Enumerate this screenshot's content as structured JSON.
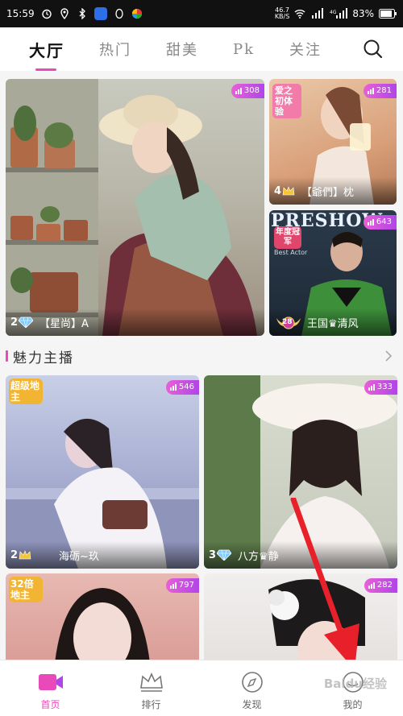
{
  "status_bar": {
    "time": "15:59",
    "net_speed_value": "46.7",
    "net_speed_unit": "KB/S",
    "battery": "83%"
  },
  "tabs": [
    {
      "label": "大厅",
      "active": true
    },
    {
      "label": "热门",
      "active": false
    },
    {
      "label": "甜美",
      "active": false
    },
    {
      "label": "Pk",
      "active": false
    },
    {
      "label": "关注",
      "active": false
    }
  ],
  "hero": {
    "big": {
      "viewers": "308",
      "level": "2",
      "name": "【星尚】A"
    },
    "top_right": {
      "viewers": "281",
      "level": "4",
      "name": "【爺們】枕",
      "poster_text": "爱之初体验"
    },
    "bottom_right": {
      "viewers": "643",
      "level": "28",
      "name": "王国♛清风",
      "poster_text": "PRESHOW",
      "award_text": "年度冠军",
      "sub_text": "Best Actor"
    }
  },
  "section": {
    "title": "魅力主播"
  },
  "grid": [
    {
      "viewers": "546",
      "level": "2",
      "name": "海砺~玖",
      "tag": "超级地主"
    },
    {
      "viewers": "333",
      "level": "3",
      "name": "八方♛静"
    },
    {
      "viewers": "797",
      "tag": "32倍地主"
    },
    {
      "viewers": "282"
    }
  ],
  "bottom_nav": [
    {
      "label": "首页",
      "icon": "video-camera-icon",
      "active": true
    },
    {
      "label": "排行",
      "icon": "crown-icon",
      "active": false
    },
    {
      "label": "发现",
      "icon": "compass-icon",
      "active": false
    },
    {
      "label": "我的",
      "icon": "profile-icon",
      "active": false
    }
  ],
  "watermark": "Baidu经验",
  "colors": {
    "accent": "#e84ab9",
    "badge_start": "#e860d8",
    "badge_end": "#b145e8",
    "annotation": "#e8202a"
  }
}
